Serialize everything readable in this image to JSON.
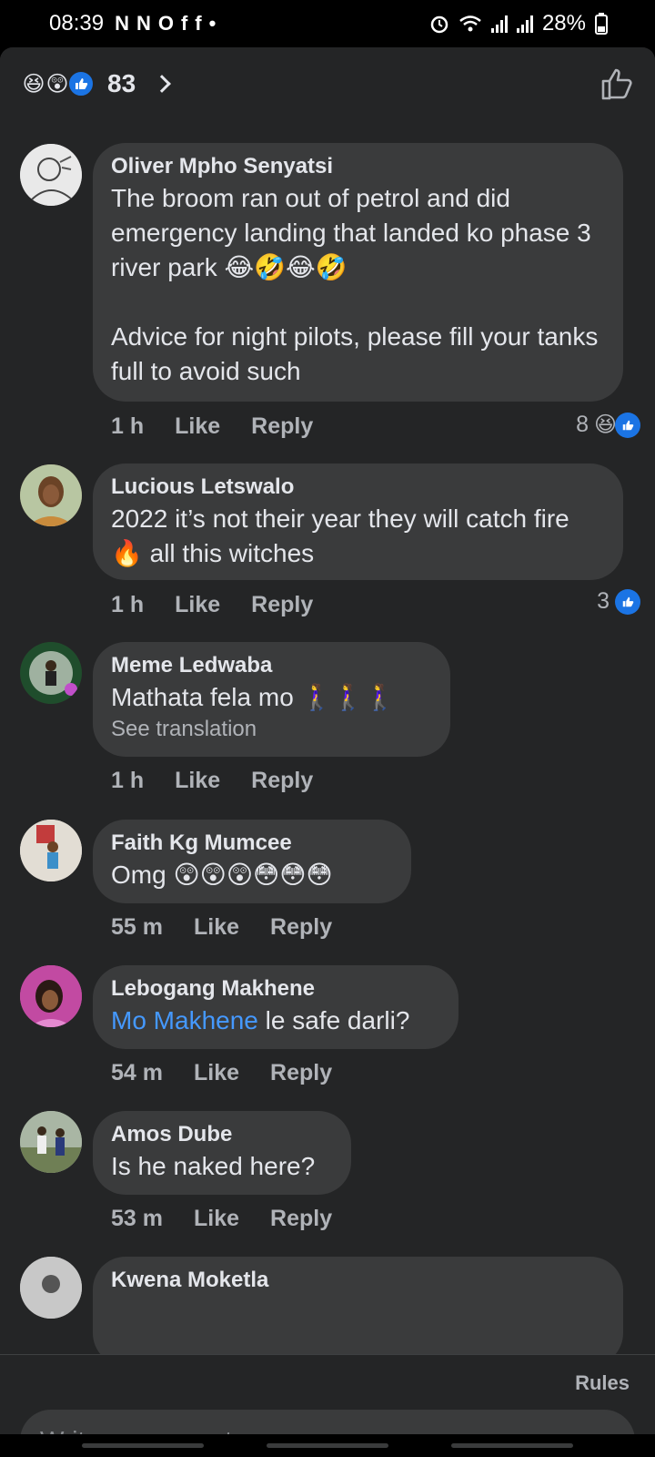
{
  "status_bar": {
    "time": "08:39",
    "notif_icons": [
      "N",
      "N",
      "O",
      "f",
      "f",
      "•"
    ],
    "battery": "28%"
  },
  "header": {
    "reaction_emojis": [
      "😆",
      "😲"
    ],
    "reaction_count": "83"
  },
  "comments": [
    {
      "author": "Oliver Mpho Senyatsi",
      "text": "The broom ran out of petrol and did emergency landing that landed ko phase 3 river park 😂🤣😂🤣\n\nAdvice for night pilots, please fill your tanks full to avoid such",
      "time": "1 h",
      "like_label": "Like",
      "reply_label": "Reply",
      "reaction_count": "8",
      "reaction_emoji": "😆"
    },
    {
      "author": "Lucious Letswalo",
      "text": "2022 it’s not their year they will catch fire 🔥 all this witches",
      "time": "1 h",
      "like_label": "Like",
      "reply_label": "Reply",
      "reaction_count": "3"
    },
    {
      "author": "Meme Ledwaba",
      "text": "Mathata fela mo 🚶‍♀️🚶‍♀️🚶‍♀️",
      "translation": "See translation",
      "time": "1 h",
      "like_label": "Like",
      "reply_label": "Reply"
    },
    {
      "author": "Faith Kg Mumcee",
      "text": "Omg 😲😲😲😳😳😳",
      "time": "55 m",
      "like_label": "Like",
      "reply_label": "Reply"
    },
    {
      "author": "Lebogang Makhene",
      "mention": "Mo Makhene",
      "text": " le safe darli?",
      "time": "54 m",
      "like_label": "Like",
      "reply_label": "Reply"
    },
    {
      "author": "Amos Dube",
      "text": "Is he naked here?",
      "time": "53 m",
      "like_label": "Like",
      "reply_label": "Reply"
    },
    {
      "author": "Kwena Moketla"
    }
  ],
  "footer": {
    "rules_label": "Rules",
    "comment_placeholder": "Write a comment…"
  },
  "colors": {
    "background": "#242526",
    "bubble": "#3a3b3c",
    "accent": "#1b74e4",
    "mention": "#4599ff"
  }
}
